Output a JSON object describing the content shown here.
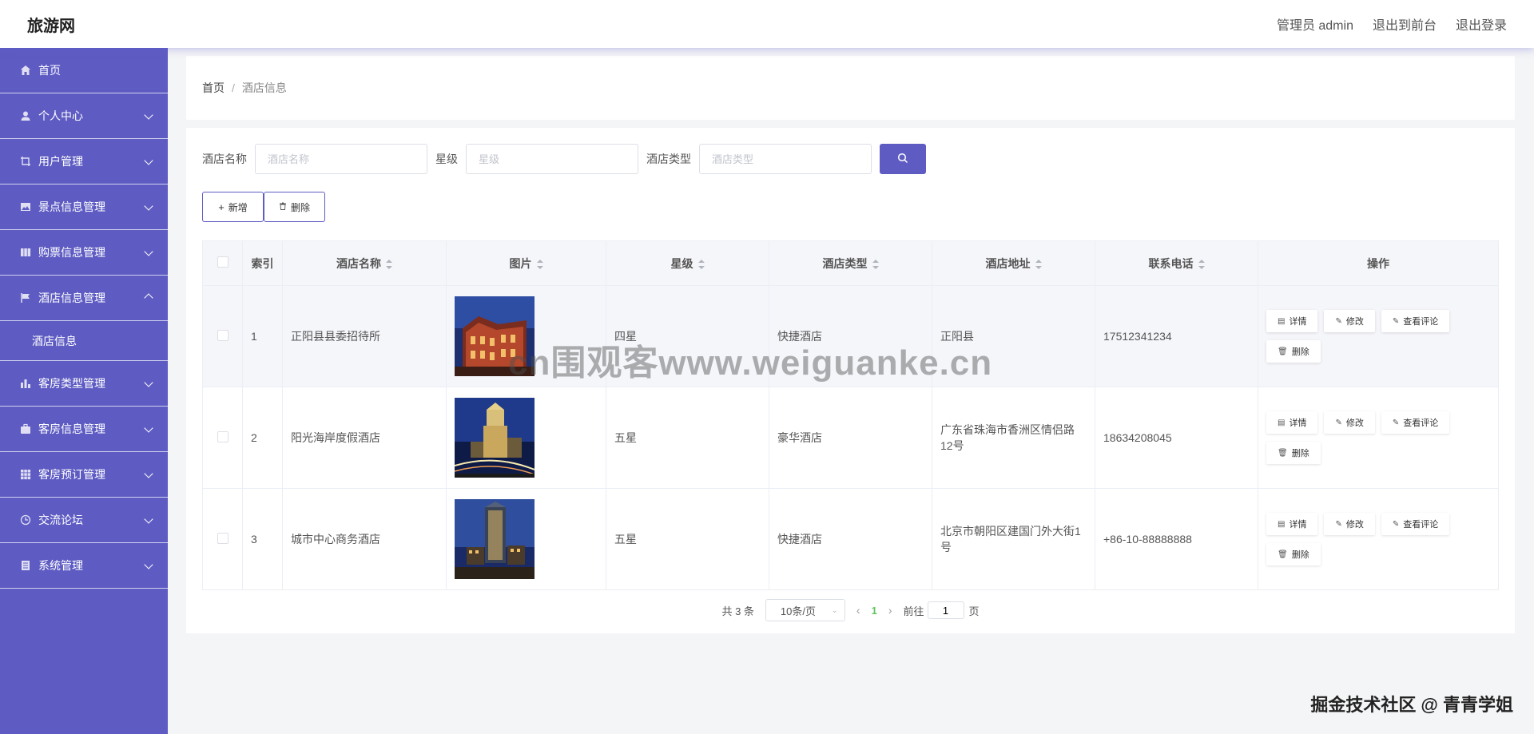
{
  "header": {
    "brand": "旅游网",
    "admin_label": "管理员 admin",
    "front_label": "退出到前台",
    "logout_label": "退出登录"
  },
  "sidebar": {
    "items": [
      {
        "label": "首页",
        "icon": "home-icon"
      },
      {
        "label": "个人中心",
        "icon": "user-icon"
      },
      {
        "label": "用户管理",
        "icon": "crop-icon"
      },
      {
        "label": "景点信息管理",
        "icon": "picture-icon"
      },
      {
        "label": "购票信息管理",
        "icon": "files-icon"
      },
      {
        "label": "酒店信息管理",
        "icon": "flag-icon"
      },
      {
        "label": "客房类型管理",
        "icon": "chart-icon"
      },
      {
        "label": "客房信息管理",
        "icon": "suitcase-icon"
      },
      {
        "label": "客房预订管理",
        "icon": "grid-icon"
      },
      {
        "label": "交流论坛",
        "icon": "clock-icon"
      },
      {
        "label": "系统管理",
        "icon": "document-icon"
      }
    ],
    "submenu": "酒店信息"
  },
  "breadcrumb": {
    "home": "首页",
    "separator": "/",
    "current": "酒店信息"
  },
  "search": {
    "name_label": "酒店名称",
    "name_placeholder": "酒店名称",
    "star_label": "星级",
    "star_placeholder": "星级",
    "type_label": "酒店类型",
    "type_placeholder": "酒店类型"
  },
  "actions": {
    "add_label": "新增",
    "delete_label": "删除"
  },
  "table": {
    "headers": {
      "index": "索引",
      "name": "酒店名称",
      "image": "图片",
      "star": "星级",
      "type": "酒店类型",
      "address": "酒店地址",
      "phone": "联系电话",
      "ops": "操作"
    },
    "rows": [
      {
        "index": "1",
        "name": "正阳县县委招待所",
        "star": "四星",
        "type": "快捷酒店",
        "address": "正阳县",
        "phone": "17512341234"
      },
      {
        "index": "2",
        "name": "阳光海岸度假酒店",
        "star": "五星",
        "type": "豪华酒店",
        "address": "广东省珠海市香洲区情侣路12号",
        "phone": "18634208045"
      },
      {
        "index": "3",
        "name": "城市中心商务酒店",
        "star": "五星",
        "type": "快捷酒店",
        "address": "北京市朝阳区建国门外大街1号",
        "phone": "+86-10-88888888"
      }
    ],
    "op_labels": {
      "detail": "详情",
      "edit": "修改",
      "comments": "查看评论",
      "delete": "删除"
    }
  },
  "pagination": {
    "total": "共 3 条",
    "page_size": "10条/页",
    "current_page": "1",
    "goto_label": "前往",
    "goto_value": "1",
    "page_suffix": "页"
  },
  "overlay": {
    "watermark": "cn围观客www.weiguanke.cn",
    "footer": "掘金技术社区 @ 青青学姐"
  },
  "colors": {
    "accent": "#5e5cc3",
    "page_active": "#5ec45e"
  }
}
